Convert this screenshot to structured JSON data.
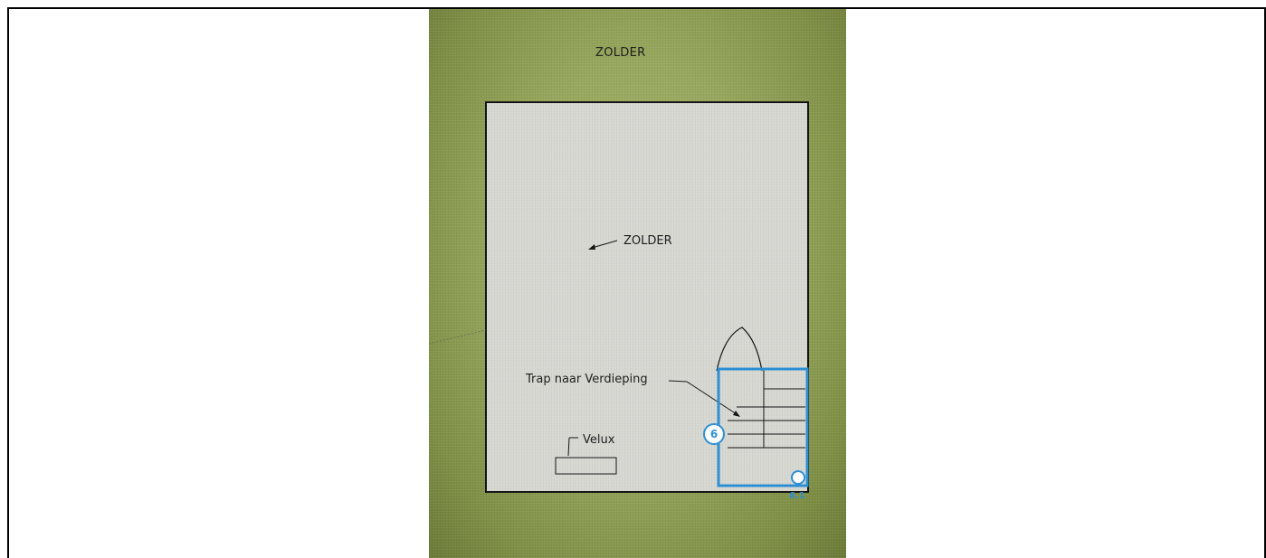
{
  "plan": {
    "title": "ZOLDER",
    "room_label": "ZOLDER",
    "stair_label": "Trap naar Verdieping",
    "velux_label": "Velux"
  },
  "markers": {
    "main": "6",
    "sub": "6.1"
  },
  "colors": {
    "marker_blue": "#2a8fd6",
    "background_green": "#98a85e",
    "paper": "#d9d9d4"
  }
}
